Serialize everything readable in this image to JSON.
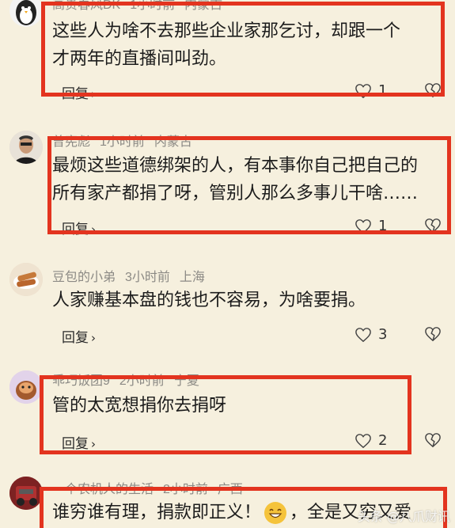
{
  "comments": [
    {
      "user": "高贵春风DK",
      "time": "1小时前",
      "location": "内蒙古",
      "line1": "这些人为啥不去那些企业家那乞讨，却跟一个",
      "line2": "才两年的直播间叫劲。",
      "reply_label": "回复",
      "likes": "1"
    },
    {
      "user": "曾宪彪",
      "time": "1小时前",
      "location": "内蒙古",
      "line1": "最烦这些道德绑架的人，有本事你自己把自己的",
      "line2": "所有家产都捐了呀，管别人那么多事儿干啥……",
      "reply_label": "回复",
      "likes": "1"
    },
    {
      "user": "豆包的小弟",
      "time": "3小时前",
      "location": "上海",
      "line1": "人家赚基本盘的钱也不容易，为啥要捐。",
      "reply_label": "回复",
      "likes": "3"
    },
    {
      "user": "乖巧饭团9",
      "time": "2小时前",
      "location": "宁夏",
      "line1": "管的太宽想捐你去捐呀",
      "reply_label": "回复",
      "likes": "2"
    },
    {
      "user": "一个农机人的生活",
      "time": "2小时前",
      "location": "广西",
      "line1a": "谁穷谁有理，捐款即正义！",
      "line1b": "，全是又穷又爱"
    }
  ],
  "watermark": "头条 @八爪财讯",
  "colors": {
    "highlight": "#e3341f",
    "background": "#f6f0de"
  }
}
